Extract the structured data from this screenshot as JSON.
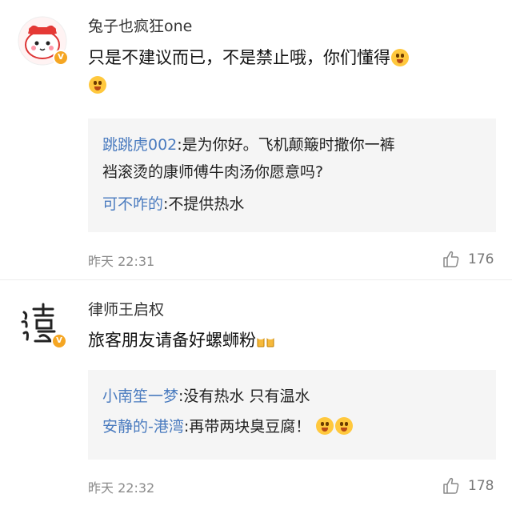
{
  "comments": [
    {
      "username": "兔子也疯狂one",
      "content": "只是不建议而已，不是禁止哦，你们懂得",
      "emojis": [
        "surprised-face-emoji",
        "surprised-face-emoji"
      ],
      "replies": [
        {
          "name": "跳跳虎002",
          "text": ":是为你好。飞机颠簸时撒你一裤",
          "text_line2": "裆滚烫的康师傅牛肉汤你愿意吗?"
        },
        {
          "name": "可不咋的",
          "text": ":不提供热水"
        }
      ],
      "time": "昨天 22:31",
      "likes": "176"
    },
    {
      "username": "律师王启权",
      "content": "旅客朋友请备好螺蛳粉",
      "emojis": [
        "beer-cheers-emoji"
      ],
      "replies": [
        {
          "name": "小南笙一梦",
          "text": ":没有热水 只有温水"
        },
        {
          "name": "安静的-港湾",
          "text": ":再带两块臭豆腐！",
          "emojis": [
            "grin-face-emoji",
            "grin-face-emoji"
          ]
        }
      ],
      "time": "昨天 22:32",
      "likes": "178"
    }
  ],
  "colors": {
    "reply_name": "#4a7bbf",
    "quote_bg": "#f5f5f5",
    "meta": "#8a8a8a",
    "badge": "#f5a623"
  },
  "icons": {
    "like": "thumbs-up-icon",
    "verified": "verified-v-badge-icon"
  }
}
